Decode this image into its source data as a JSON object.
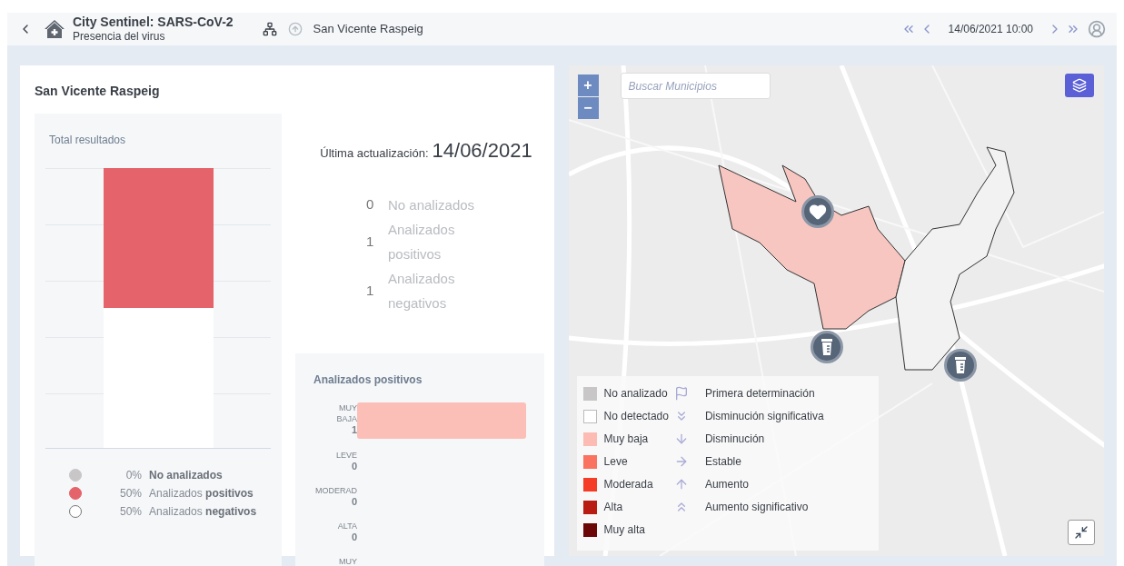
{
  "header": {
    "title": "City Sentinel: SARS-CoV-2",
    "subtitle": "Presencia del virus",
    "location": "San Vicente Raspeig",
    "date": "14/06/2021 10:00"
  },
  "card": {
    "title": "San Vicente Raspeig",
    "total": {
      "title": "Total resultados",
      "legend": [
        {
          "percent": "0%",
          "label": "**No analizados**",
          "color": "#c8c6c6",
          "level": 0
        },
        {
          "percent": "50%",
          "label": "Analizados **positivos**",
          "color": "#e5636a",
          "level": 0.5
        },
        {
          "percent": "50%",
          "label": "Analizados **negativos**",
          "color": "#ffffff",
          "level": 0.5
        }
      ]
    },
    "update_label": "Última actualización:",
    "update_date": "14/06/2021",
    "counts": [
      {
        "value": "0",
        "label": "No analizados"
      },
      {
        "value": "1",
        "label": "Analizados positivos"
      },
      {
        "value": "1",
        "label": "Analizados negativos"
      }
    ],
    "positives": {
      "title": "Analizados positivos",
      "chart_data": {
        "type": "bar",
        "orientation": "horizontal",
        "categories": [
          "MUY BAJA",
          "LEVE",
          "MODERAD",
          "ALTA",
          "MUY"
        ],
        "values": [
          1,
          0,
          0,
          0,
          null
        ],
        "value_labels": [
          "1",
          "0",
          "0",
          "0",
          null
        ]
      }
    }
  },
  "map": {
    "search": {
      "placeholder": "Buscar Municipios"
    },
    "zoom_in": "+",
    "zoom_out": "−",
    "levels": [
      {
        "label": "No analizado",
        "color": "#c8c6c6"
      },
      {
        "label": "No detectado",
        "color": "#ffffff"
      },
      {
        "label": "Muy baja",
        "color": "#fcbcb3"
      },
      {
        "label": "Leve",
        "color": "#f97360"
      },
      {
        "label": "Moderada",
        "color": "#f43c26"
      },
      {
        "label": "Alta",
        "color": "#b81c12"
      },
      {
        "label": "Muy alta",
        "color": "#6b0707"
      }
    ],
    "trends": [
      {
        "kind": "flag",
        "label": "Primera determinación"
      },
      {
        "kind": "double-down",
        "label": "Disminución significativa"
      },
      {
        "kind": "down",
        "label": "Disminución"
      },
      {
        "kind": "right",
        "label": "Estable"
      },
      {
        "kind": "up",
        "label": "Aumento"
      },
      {
        "kind": "double-up",
        "label": "Aumento significativo"
      }
    ]
  }
}
